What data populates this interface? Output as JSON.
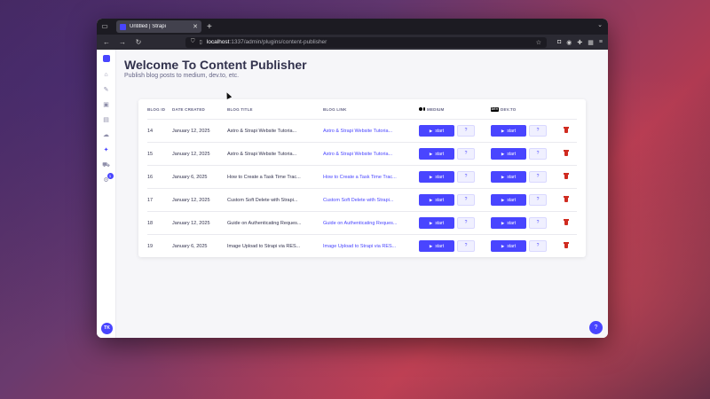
{
  "browser": {
    "tab_title": "Untitled | Strapi",
    "url_host": "localhost",
    "url_path": ":1337/admin/plugins/content-publisher"
  },
  "sidebar": {
    "items": [
      {
        "icon": "home-icon",
        "glyph": "⌂"
      },
      {
        "icon": "feather-icon",
        "glyph": "✎"
      },
      {
        "icon": "media-icon",
        "glyph": "▣"
      },
      {
        "icon": "layout-icon",
        "glyph": "▤"
      },
      {
        "icon": "cloud-icon",
        "glyph": "☁"
      },
      {
        "icon": "plugin-icon",
        "glyph": "✦"
      },
      {
        "icon": "cart-icon",
        "glyph": "⛟"
      },
      {
        "icon": "settings-icon",
        "glyph": "⚙"
      }
    ],
    "settings_badge": "1",
    "avatar_initials": "TK"
  },
  "header": {
    "title": "Welcome To Content Publisher",
    "subtitle": "Publish blog posts to medium, dev.to, etc."
  },
  "table": {
    "columns": {
      "id": "BLOG ID",
      "date": "DATE CREATED",
      "title": "BLOG TITLE",
      "link": "BLOG LINK",
      "medium": "MEDIUM",
      "devto": "DEV.TO",
      "devto_logo": "DEV"
    },
    "start_label": "start",
    "help_label": "?",
    "rows": [
      {
        "id": "14",
        "date": "January 12, 2025",
        "title": "Astro & Strapi Website Tutoria...",
        "link": "Astro & Strapi Website Tutoria..."
      },
      {
        "id": "15",
        "date": "January 12, 2025",
        "title": "Astro & Strapi Website Tutoria...",
        "link": "Astro & Strapi Website Tutoria..."
      },
      {
        "id": "16",
        "date": "January 6, 2025",
        "title": "How to Create a Task Time Trac...",
        "link": "How to Create a Task Time Trac..."
      },
      {
        "id": "17",
        "date": "January 12, 2025",
        "title": "Custom Soft Delete with Strapi...",
        "link": "Custom Soft Delete with Strapi..."
      },
      {
        "id": "18",
        "date": "January 12, 2025",
        "title": "Guide on Authenticating Reques...",
        "link": "Guide on Authenticating Reques..."
      },
      {
        "id": "19",
        "date": "January 6, 2025",
        "title": "Image Upload to Strapi via RES...",
        "link": "Image Upload to Strapi via RES..."
      }
    ]
  },
  "colors": {
    "accent": "#4945ff",
    "danger": "#d02b20"
  }
}
